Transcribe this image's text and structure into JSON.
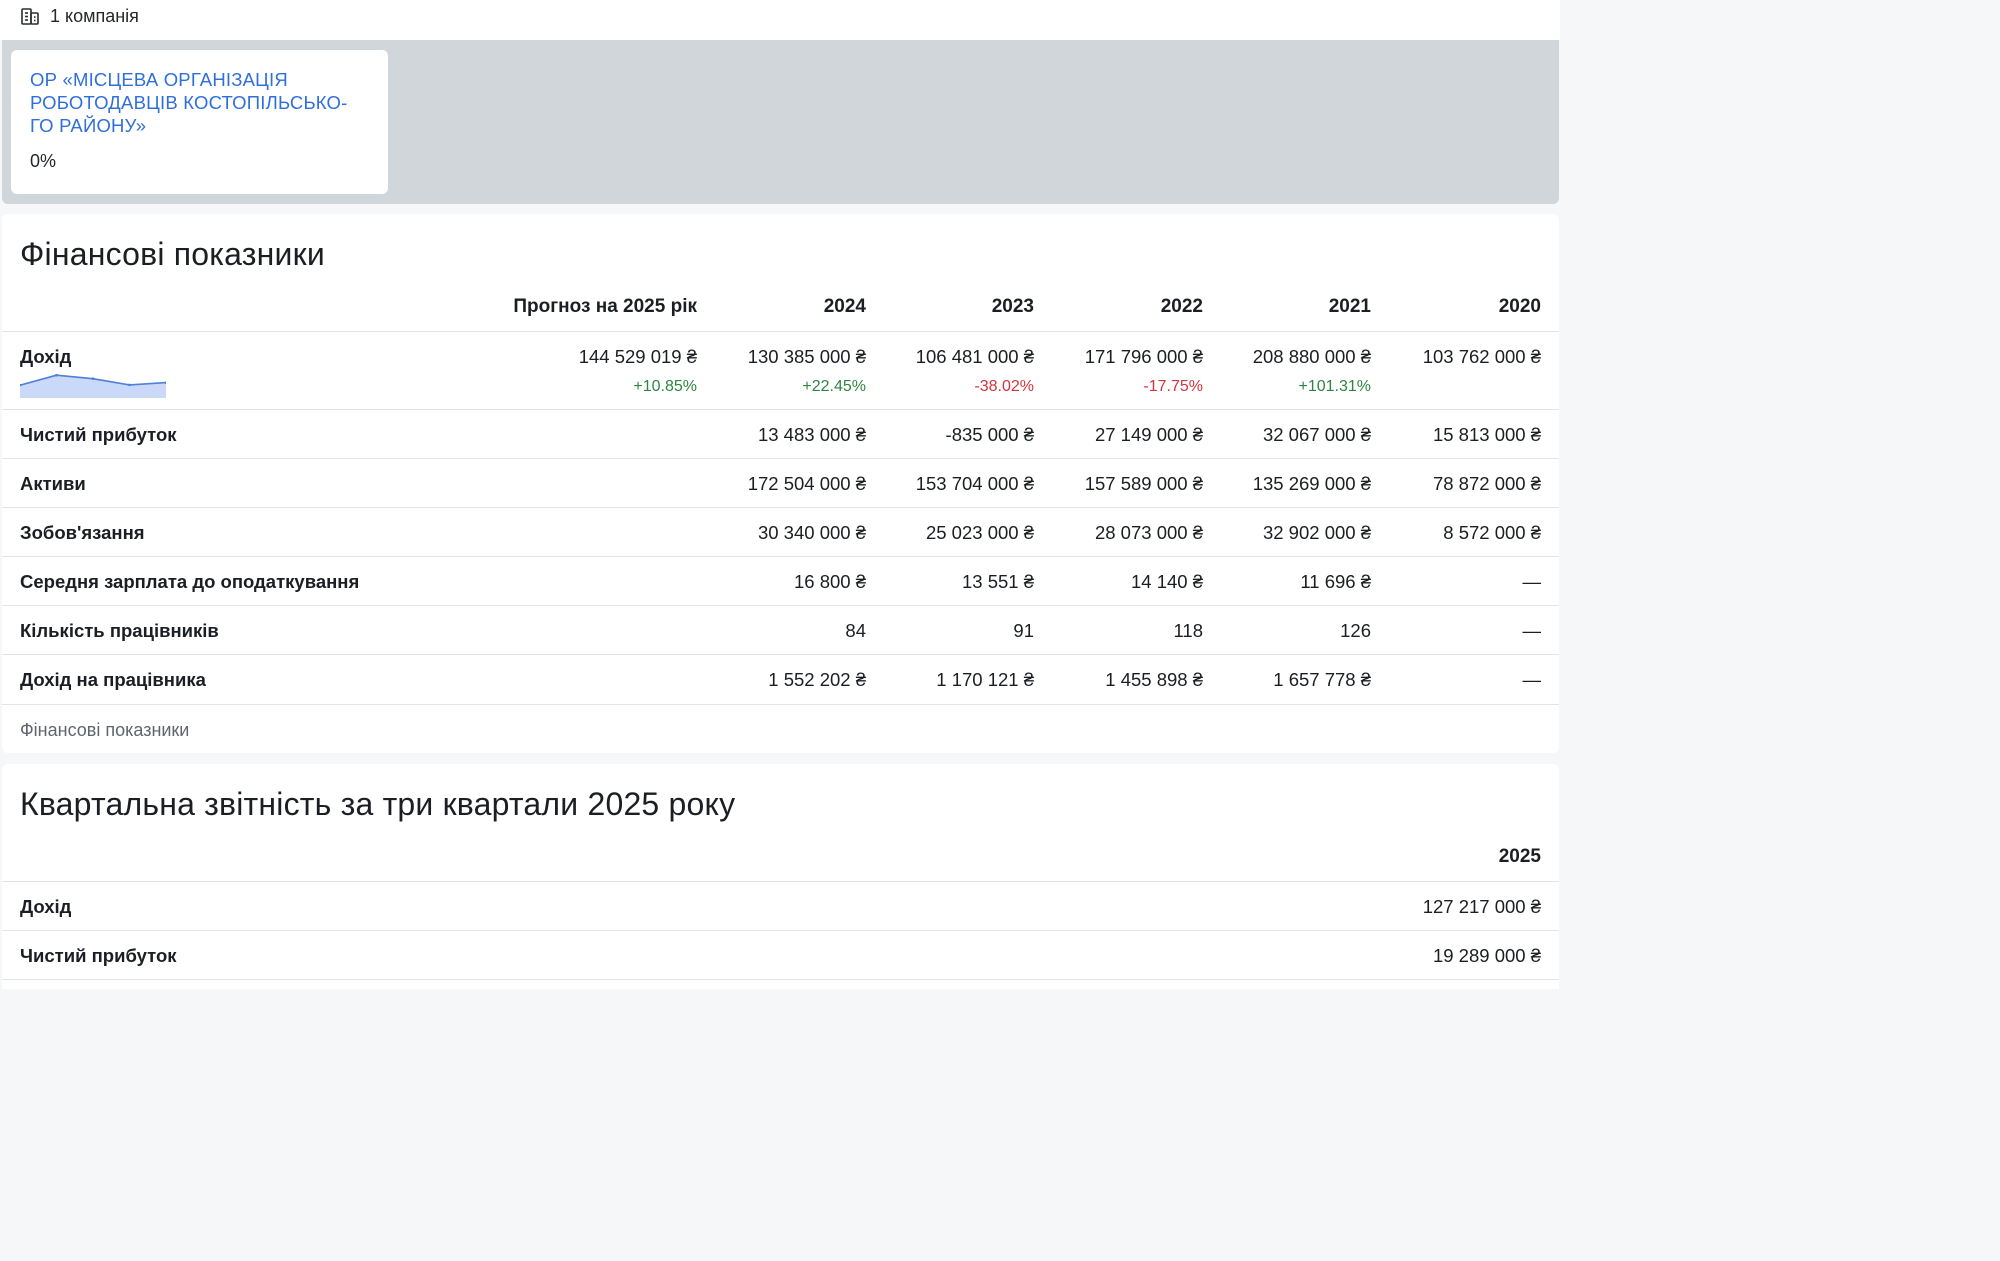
{
  "header": {
    "companies_count_label": "1 компанія",
    "icon": "building-icon"
  },
  "company_card": {
    "name": "ОР «МІСЦЕВА ОРГАНІЗАЦІЯ РОБОТОДАВЦІВ КОСТОПІЛЬСЬКО-ГО РАЙОНУ»",
    "share": "0%"
  },
  "colors": {
    "link": "#2f6fdc",
    "positive": "#2e8540",
    "negative": "#d0343c",
    "sparkline_line": "#4f7fd9",
    "sparkline_fill": "#c9d9f7"
  },
  "financials": {
    "title": "Фінансові показники",
    "columns": [
      "Прогноз на 2025 рік",
      "2024",
      "2023",
      "2022",
      "2021",
      "2020"
    ],
    "revenue": {
      "label": "Дохід",
      "values": [
        "144 529 019 ₴",
        "130 385 000 ₴",
        "106 481 000 ₴",
        "171 796 000 ₴",
        "208 880 000 ₴",
        "103 762 000 ₴"
      ],
      "changes": [
        "+10.85%",
        "+22.45%",
        "-38.02%",
        "-17.75%",
        "+101.31%",
        ""
      ],
      "sparkline": [
        103762000,
        208880000,
        171796000,
        106481000,
        130385000
      ]
    },
    "rows": [
      {
        "label": "Чистий прибуток",
        "values": [
          "",
          "13 483 000 ₴",
          "-835 000 ₴",
          "27 149 000 ₴",
          "32 067 000 ₴",
          "15 813 000 ₴"
        ]
      },
      {
        "label": "Активи",
        "values": [
          "",
          "172 504 000 ₴",
          "153 704 000 ₴",
          "157 589 000 ₴",
          "135 269 000 ₴",
          "78 872 000 ₴"
        ]
      },
      {
        "label": "Зобов'язання",
        "values": [
          "",
          "30 340 000 ₴",
          "25 023 000 ₴",
          "28 073 000 ₴",
          "32 902 000 ₴",
          "8 572 000 ₴"
        ]
      },
      {
        "label": "Середня зарплата до оподаткування",
        "values": [
          "",
          "16 800 ₴",
          "13 551 ₴",
          "14 140 ₴",
          "11 696 ₴",
          "—"
        ]
      },
      {
        "label": "Кількість працівників",
        "values": [
          "",
          "84",
          "91",
          "118",
          "126",
          "—"
        ]
      },
      {
        "label": "Дохід на працівника",
        "values": [
          "",
          "1 552 202 ₴",
          "1 170 121 ₴",
          "1 455 898 ₴",
          "1 657 778 ₴",
          "—"
        ]
      }
    ],
    "footer": "Фінансові показники"
  },
  "quarterly": {
    "title": "Квартальна звітність за три квартали 2025 року",
    "column": "2025",
    "rows": [
      {
        "label": "Дохід",
        "value": "127 217 000 ₴"
      },
      {
        "label": "Чистий прибуток",
        "value": "19 289 000 ₴"
      }
    ]
  }
}
